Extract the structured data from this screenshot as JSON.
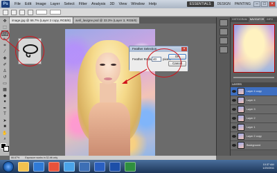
{
  "menubar": {
    "logo": "Ps",
    "items": [
      "File",
      "Edit",
      "Image",
      "Layer",
      "Select",
      "Filter",
      "Analysis",
      "3D",
      "View",
      "Window",
      "Help"
    ],
    "workspace": "ESSENTIALS",
    "workspace_links": [
      "DESIGN",
      "PAINTING"
    ]
  },
  "doc_tabs": [
    "image.jpg @ 66.7% (Layer 2 copy, RGB/8)",
    "avril_lavigne.psd @ 33.3% (Layer 3, RGB/8)"
  ],
  "dialog": {
    "title": "Feather Selection",
    "feather_label": "Feather Radius:",
    "feather_value": "40",
    "feather_unit": "pixels",
    "ok_label": "OK",
    "cancel_label": "Cancel"
  },
  "panels": {
    "top_tabs": [
      "HISTOGRAM",
      "NAVIGATOR",
      "INFO"
    ],
    "layers_tab": "LAYERS",
    "layers": [
      {
        "name": "Layer 4 copy",
        "active": true
      },
      {
        "name": "Layer 4",
        "active": false
      },
      {
        "name": "Layer 3",
        "active": false
      },
      {
        "name": "Layer 2",
        "active": false
      },
      {
        "name": "Layer 1",
        "active": false
      },
      {
        "name": "Layer 2 copy",
        "active": false
      },
      {
        "name": "Background",
        "active": false
      }
    ]
  },
  "status": {
    "zoom": "66.67%",
    "doc": "Exposure works in 32-bit only"
  },
  "taskbar": {
    "time": "10:37 AM",
    "date": "1/20/2011",
    "icon_colors": [
      "#f2c14e",
      "#2f7ad6",
      "#e8523a",
      "#4aa3e8",
      "#3d6fb5",
      "#2a5fc0",
      "#1d4fa8",
      "#2f8f3f"
    ]
  },
  "colors": {
    "annotation": "#d0131b",
    "active_layer": "#3e6fc1"
  }
}
